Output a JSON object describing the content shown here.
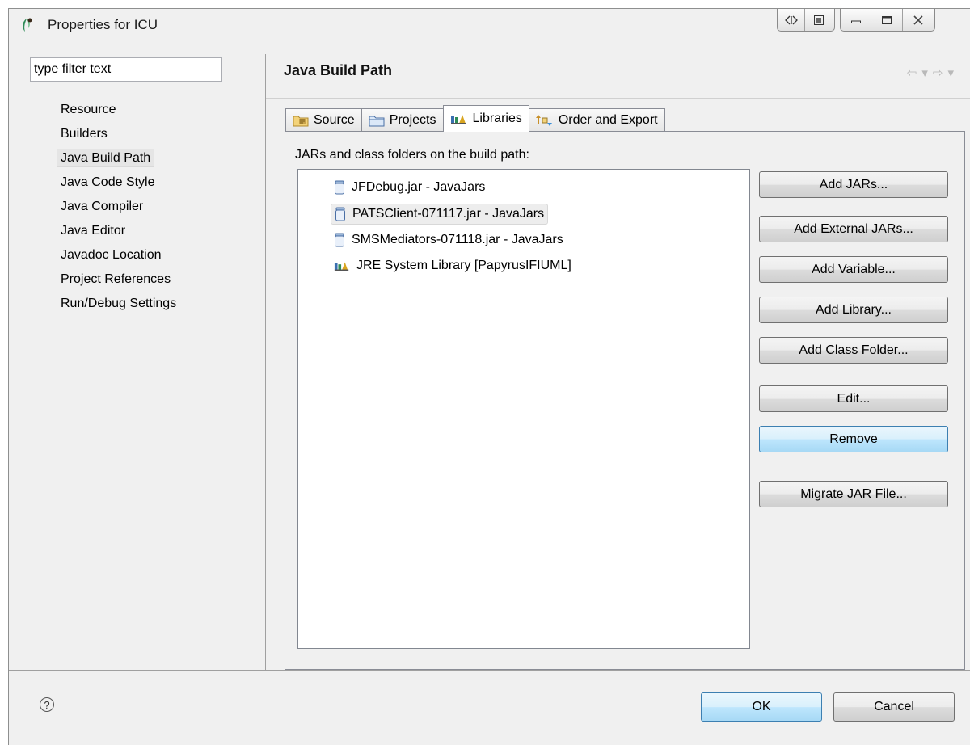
{
  "window": {
    "title": "Properties for ICU",
    "controls": [
      {
        "name": "move-icon",
        "glyph": "⊲⊳"
      },
      {
        "name": "restore-pane-icon",
        "glyph": "⧉"
      },
      {
        "name": "minimize-icon",
        "glyph": "—"
      },
      {
        "name": "maximize-icon",
        "glyph": "▢"
      },
      {
        "name": "close-icon",
        "glyph": "☒"
      }
    ]
  },
  "sidebar": {
    "filter_value": "type filter text",
    "items": [
      {
        "label": "Resource"
      },
      {
        "label": "Builders"
      },
      {
        "label": "Java Build Path",
        "selected": true
      },
      {
        "label": "Java Code Style"
      },
      {
        "label": "Java Compiler"
      },
      {
        "label": "Java Editor"
      },
      {
        "label": "Javadoc Location"
      },
      {
        "label": "Project References"
      },
      {
        "label": "Run/Debug Settings"
      }
    ]
  },
  "main": {
    "title": "Java Build Path",
    "tabs": [
      {
        "label": "Source",
        "icon": "source-folder-icon"
      },
      {
        "label": "Projects",
        "icon": "projects-folder-icon"
      },
      {
        "label": "Libraries",
        "icon": "libraries-icon",
        "active": true
      },
      {
        "label": "Order and Export",
        "icon": "order-export-icon"
      }
    ],
    "list_label": "JARs and class folders on the build path:",
    "entries": [
      {
        "label": "JFDebug.jar - JavaJars",
        "icon": "jar-icon"
      },
      {
        "label": "PATSClient-071117.jar - JavaJars",
        "icon": "jar-icon",
        "selected": true
      },
      {
        "label": "SMSMediators-071118.jar - JavaJars",
        "icon": "jar-icon"
      },
      {
        "label": "JRE System Library [PapyrusIFIUML]",
        "icon": "library-icon"
      }
    ],
    "buttons": {
      "add_jars": "Add JARs...",
      "add_external_jars": "Add External JARs...",
      "add_variable": "Add Variable...",
      "add_library": "Add Library...",
      "add_class_folder": "Add Class Folder...",
      "edit": "Edit...",
      "remove": "Remove",
      "migrate_jar": "Migrate JAR File..."
    }
  },
  "footer": {
    "help_glyph": "?",
    "ok": "OK",
    "cancel": "Cancel"
  },
  "colors": {
    "dialog_bg": "#f0f0f0",
    "button_hover_bg": "#bee6fd",
    "button_hover_border": "#3c7fb1"
  }
}
